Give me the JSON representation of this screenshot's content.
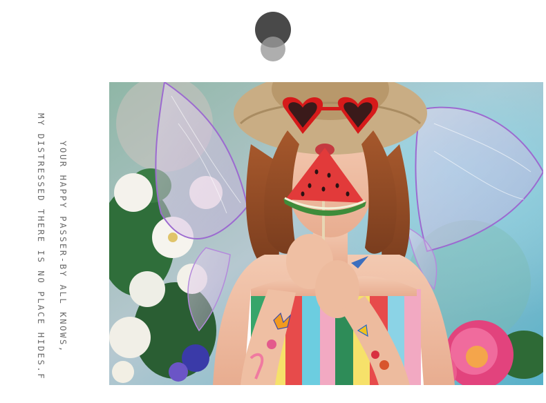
{
  "caption": {
    "line1": "YOUR HAPPY PASSER-BY ALL KNOWS,",
    "line2": "MY DISTRESSED THERE IS NO PLACE HIDES.F"
  },
  "colors": {
    "background": "#ffffff",
    "text": "#6a6a6a",
    "logo_dark": "#3f3f3f",
    "logo_light": "#9a9a9a"
  }
}
